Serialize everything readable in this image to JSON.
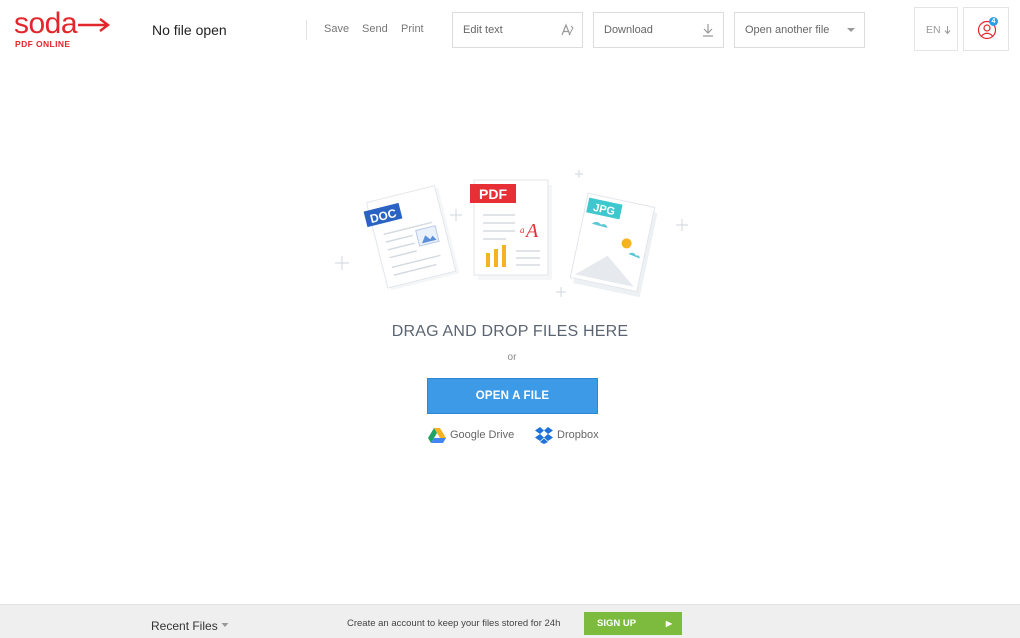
{
  "header": {
    "logo_text": "soda",
    "logo_subtext": "PDF ONLINE",
    "file_title": "No file open",
    "menu": {
      "save": "Save",
      "send": "Send",
      "print": "Print"
    },
    "edit_text": "Edit text",
    "download": "Download",
    "open_another": "Open another file",
    "language": "EN",
    "notification_count": "4"
  },
  "illustration": {
    "doc_label": "DOC",
    "pdf_label": "PDF",
    "jpg_label": "JPG"
  },
  "main": {
    "drop_text": "DRAG AND DROP FILES HERE",
    "or_text": "or",
    "open_button": "OPEN A FILE",
    "google_drive": "Google Drive",
    "dropbox": "Dropbox"
  },
  "footer": {
    "recent_files": "Recent Files",
    "message": "Create an account to keep your files stored for 24h",
    "signup": "SIGN UP"
  },
  "colors": {
    "brand_red": "#e3262b",
    "primary_blue": "#3d9ae6",
    "signup_green": "#7cbb3e"
  }
}
